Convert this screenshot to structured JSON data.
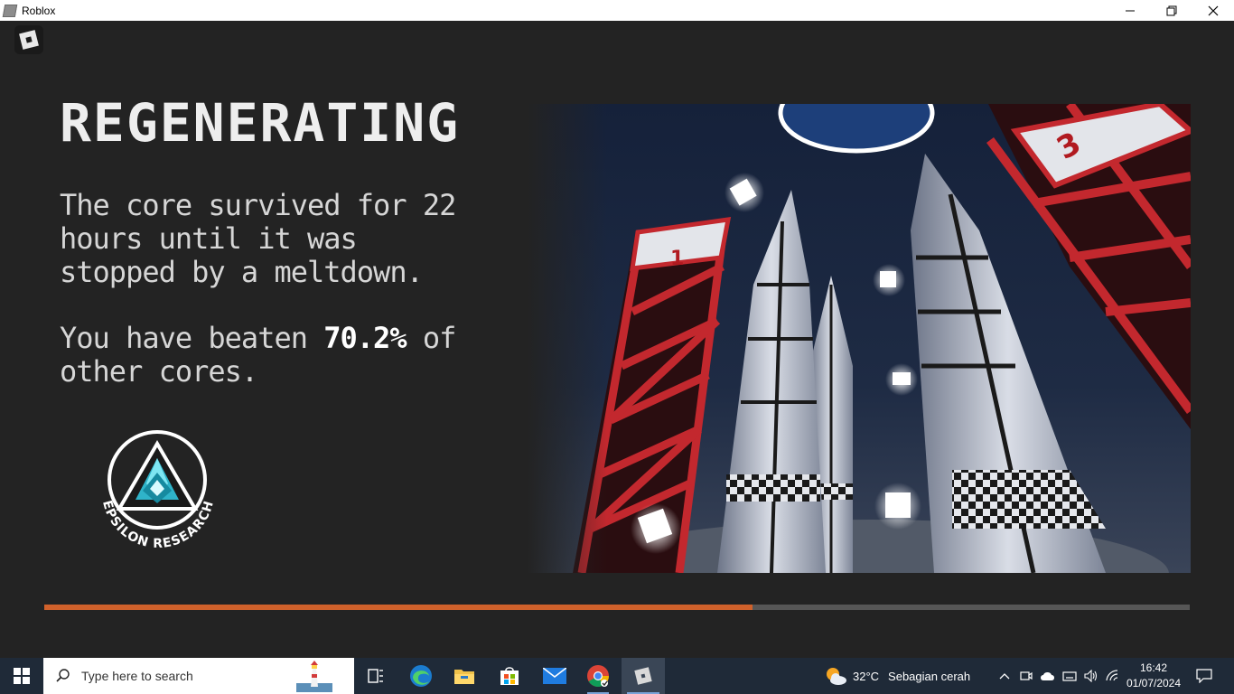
{
  "window": {
    "title": "Roblox",
    "icon": "roblox-icon"
  },
  "game": {
    "heading": "REGENERATING",
    "survival_text": "The core survived for 22 hours until it was stopped by a meltdown.",
    "beaten_prefix": "You have beaten ",
    "beaten_percent": "70.2%",
    "beaten_suffix": " of other cores.",
    "logo_text": "EPSILON RESEARCH",
    "silo_number_1": "1",
    "silo_number_3": "3",
    "progress": 0.618,
    "progress_color": "#d0612b",
    "track_color": "#565656"
  },
  "taskbar": {
    "search_placeholder": "Type here to search",
    "apps": [
      "task-view-icon",
      "edge-icon",
      "file-explorer-icon",
      "store-icon",
      "mail-icon",
      "chrome-icon",
      "roblox-icon"
    ],
    "weather": {
      "temperature": "32°C",
      "condition": "Sebagian cerah"
    },
    "time": "16:42",
    "date": "01/07/2024"
  }
}
